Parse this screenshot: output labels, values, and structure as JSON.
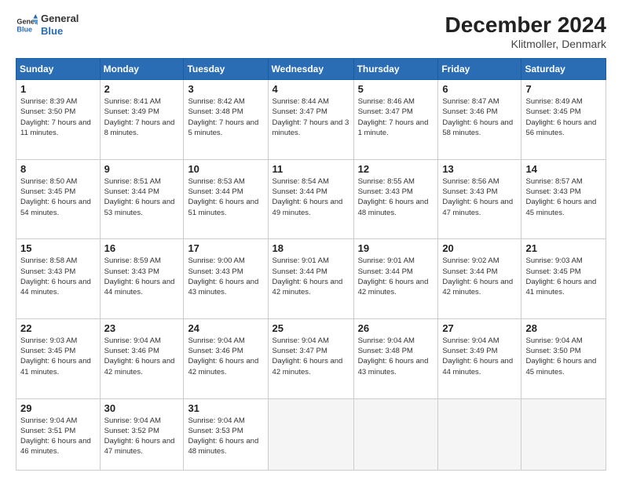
{
  "logo": {
    "line1": "General",
    "line2": "Blue"
  },
  "title": "December 2024",
  "subtitle": "Klitmoller, Denmark",
  "days_of_week": [
    "Sunday",
    "Monday",
    "Tuesday",
    "Wednesday",
    "Thursday",
    "Friday",
    "Saturday"
  ],
  "weeks": [
    [
      {
        "day": "1",
        "sunrise": "8:39 AM",
        "sunset": "3:50 PM",
        "daylight": "7 hours and 11 minutes."
      },
      {
        "day": "2",
        "sunrise": "8:41 AM",
        "sunset": "3:49 PM",
        "daylight": "7 hours and 8 minutes."
      },
      {
        "day": "3",
        "sunrise": "8:42 AM",
        "sunset": "3:48 PM",
        "daylight": "7 hours and 5 minutes."
      },
      {
        "day": "4",
        "sunrise": "8:44 AM",
        "sunset": "3:47 PM",
        "daylight": "7 hours and 3 minutes."
      },
      {
        "day": "5",
        "sunrise": "8:46 AM",
        "sunset": "3:47 PM",
        "daylight": "7 hours and 1 minute."
      },
      {
        "day": "6",
        "sunrise": "8:47 AM",
        "sunset": "3:46 PM",
        "daylight": "6 hours and 58 minutes."
      },
      {
        "day": "7",
        "sunrise": "8:49 AM",
        "sunset": "3:45 PM",
        "daylight": "6 hours and 56 minutes."
      }
    ],
    [
      {
        "day": "8",
        "sunrise": "8:50 AM",
        "sunset": "3:45 PM",
        "daylight": "6 hours and 54 minutes."
      },
      {
        "day": "9",
        "sunrise": "8:51 AM",
        "sunset": "3:44 PM",
        "daylight": "6 hours and 53 minutes."
      },
      {
        "day": "10",
        "sunrise": "8:53 AM",
        "sunset": "3:44 PM",
        "daylight": "6 hours and 51 minutes."
      },
      {
        "day": "11",
        "sunrise": "8:54 AM",
        "sunset": "3:44 PM",
        "daylight": "6 hours and 49 minutes."
      },
      {
        "day": "12",
        "sunrise": "8:55 AM",
        "sunset": "3:43 PM",
        "daylight": "6 hours and 48 minutes."
      },
      {
        "day": "13",
        "sunrise": "8:56 AM",
        "sunset": "3:43 PM",
        "daylight": "6 hours and 47 minutes."
      },
      {
        "day": "14",
        "sunrise": "8:57 AM",
        "sunset": "3:43 PM",
        "daylight": "6 hours and 45 minutes."
      }
    ],
    [
      {
        "day": "15",
        "sunrise": "8:58 AM",
        "sunset": "3:43 PM",
        "daylight": "6 hours and 44 minutes."
      },
      {
        "day": "16",
        "sunrise": "8:59 AM",
        "sunset": "3:43 PM",
        "daylight": "6 hours and 44 minutes."
      },
      {
        "day": "17",
        "sunrise": "9:00 AM",
        "sunset": "3:43 PM",
        "daylight": "6 hours and 43 minutes."
      },
      {
        "day": "18",
        "sunrise": "9:01 AM",
        "sunset": "3:44 PM",
        "daylight": "6 hours and 42 minutes."
      },
      {
        "day": "19",
        "sunrise": "9:01 AM",
        "sunset": "3:44 PM",
        "daylight": "6 hours and 42 minutes."
      },
      {
        "day": "20",
        "sunrise": "9:02 AM",
        "sunset": "3:44 PM",
        "daylight": "6 hours and 42 minutes."
      },
      {
        "day": "21",
        "sunrise": "9:03 AM",
        "sunset": "3:45 PM",
        "daylight": "6 hours and 41 minutes."
      }
    ],
    [
      {
        "day": "22",
        "sunrise": "9:03 AM",
        "sunset": "3:45 PM",
        "daylight": "6 hours and 41 minutes."
      },
      {
        "day": "23",
        "sunrise": "9:04 AM",
        "sunset": "3:46 PM",
        "daylight": "6 hours and 42 minutes."
      },
      {
        "day": "24",
        "sunrise": "9:04 AM",
        "sunset": "3:46 PM",
        "daylight": "6 hours and 42 minutes."
      },
      {
        "day": "25",
        "sunrise": "9:04 AM",
        "sunset": "3:47 PM",
        "daylight": "6 hours and 42 minutes."
      },
      {
        "day": "26",
        "sunrise": "9:04 AM",
        "sunset": "3:48 PM",
        "daylight": "6 hours and 43 minutes."
      },
      {
        "day": "27",
        "sunrise": "9:04 AM",
        "sunset": "3:49 PM",
        "daylight": "6 hours and 44 minutes."
      },
      {
        "day": "28",
        "sunrise": "9:04 AM",
        "sunset": "3:50 PM",
        "daylight": "6 hours and 45 minutes."
      }
    ],
    [
      {
        "day": "29",
        "sunrise": "9:04 AM",
        "sunset": "3:51 PM",
        "daylight": "6 hours and 46 minutes."
      },
      {
        "day": "30",
        "sunrise": "9:04 AM",
        "sunset": "3:52 PM",
        "daylight": "6 hours and 47 minutes."
      },
      {
        "day": "31",
        "sunrise": "9:04 AM",
        "sunset": "3:53 PM",
        "daylight": "6 hours and 48 minutes."
      },
      null,
      null,
      null,
      null
    ]
  ],
  "labels": {
    "sunrise": "Sunrise:",
    "sunset": "Sunset:",
    "daylight": "Daylight:"
  }
}
